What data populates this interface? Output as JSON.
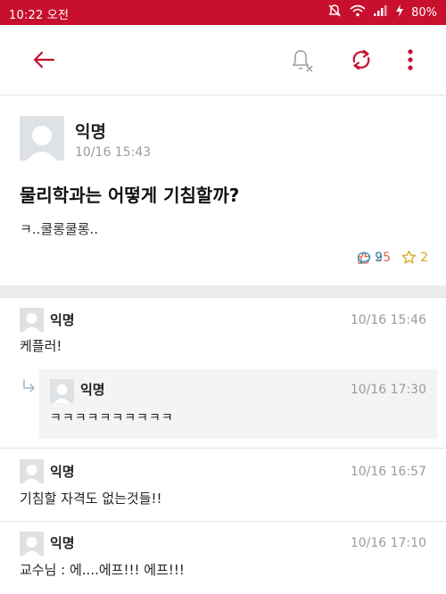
{
  "status_bar": {
    "time": "10:22 오전",
    "battery_percent": "80%",
    "icons": [
      "mute-icon",
      "wifi-icon",
      "signal-icon",
      "charging-icon"
    ]
  },
  "toolbar": {
    "icons": [
      "back-arrow-icon",
      "notification-off-icon",
      "refresh-icon",
      "more-vertical-icon"
    ],
    "accent_color": "#c8102e"
  },
  "post": {
    "author": "익명",
    "date": "10/16 15:43",
    "title": "물리학과는 어떻게 기침할까?",
    "body": "ㅋ..쿨롱쿨롱..",
    "likes": "25",
    "comments": "9",
    "scraps": "2"
  },
  "comments": [
    {
      "author": "익명",
      "date": "10/16 15:46",
      "text": "케플러!",
      "replies": [
        {
          "author": "익명",
          "date": "10/16 17:30",
          "text": "ㅋㅋㅋㅋㅋㅋㅋㅋㅋㅋ"
        }
      ]
    },
    {
      "author": "익명",
      "date": "10/16 16:57",
      "text": "기침할 자격도 없는것들!!"
    },
    {
      "author": "익명",
      "date": "10/16 17:10",
      "text": "교수님 : 에....에프!!! 에프!!!"
    }
  ]
}
